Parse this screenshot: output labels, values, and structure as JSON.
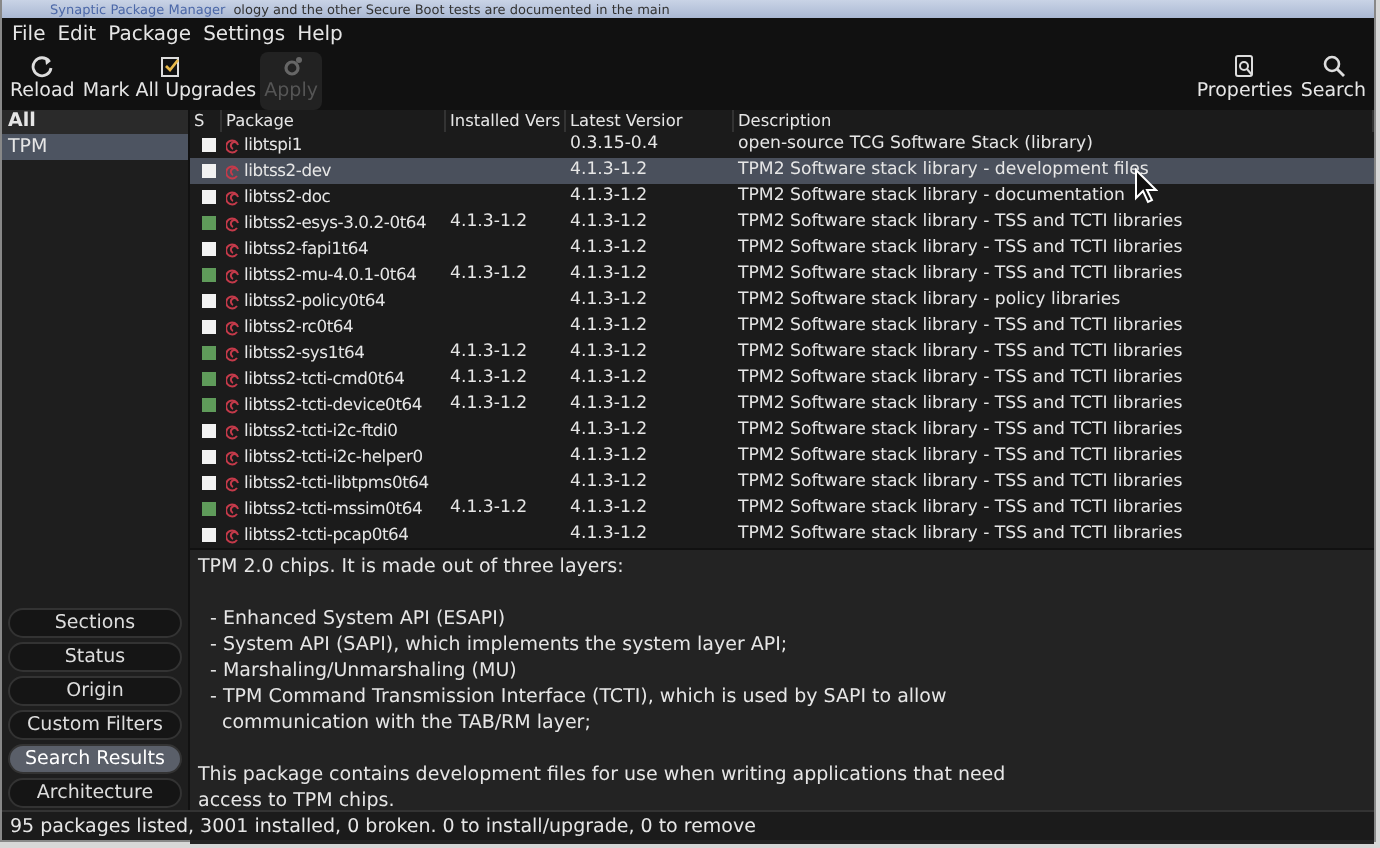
{
  "window": {
    "title": "Synaptic Package Manager",
    "behind_text": "ology and the other Secure Boot tests are documented in the main"
  },
  "menu": [
    "File",
    "Edit",
    "Package",
    "Settings",
    "Help"
  ],
  "toolbar": [
    {
      "label": "Reload",
      "disabled": false
    },
    {
      "label": "Mark All Upgrades",
      "disabled": false
    },
    {
      "label": "Apply",
      "disabled": true
    },
    {
      "label": "Properties",
      "disabled": false
    },
    {
      "label": "Search",
      "disabled": false
    }
  ],
  "filters": {
    "heading": "All",
    "items": [
      {
        "label": "TPM",
        "selected": true
      }
    ]
  },
  "filter_buttons": [
    {
      "label": "Sections",
      "selected": false
    },
    {
      "label": "Status",
      "selected": false
    },
    {
      "label": "Origin",
      "selected": false
    },
    {
      "label": "Custom Filters",
      "selected": false
    },
    {
      "label": "Search Results",
      "selected": true
    },
    {
      "label": "Architecture",
      "selected": false
    }
  ],
  "table": {
    "columns": [
      "S",
      "Package",
      "Installed Vers",
      "Latest Versior",
      "Description"
    ],
    "rows": [
      {
        "installed": false,
        "selected": false,
        "package": "libtspi1",
        "latest": "0.3.15-0.4",
        "description": "open-source TCG Software Stack (library)"
      },
      {
        "installed": false,
        "selected": true,
        "package": "libtss2-dev",
        "latest": "4.1.3-1.2",
        "description": "TPM2 Software stack library - development files"
      },
      {
        "installed": false,
        "selected": false,
        "package": "libtss2-doc",
        "latest": "4.1.3-1.2",
        "description": "TPM2 Software stack library - documentation"
      },
      {
        "installed": true,
        "selected": false,
        "package": "libtss2-esys-3.0.2-0t64",
        "installed_version": "4.1.3-1.2",
        "latest": "4.1.3-1.2",
        "description": "TPM2 Software stack library - TSS and TCTI libraries"
      },
      {
        "installed": false,
        "selected": false,
        "package": "libtss2-fapi1t64",
        "latest": "4.1.3-1.2",
        "description": "TPM2 Software stack library - TSS and TCTI libraries"
      },
      {
        "installed": true,
        "selected": false,
        "package": "libtss2-mu-4.0.1-0t64",
        "installed_version": "4.1.3-1.2",
        "latest": "4.1.3-1.2",
        "description": "TPM2 Software stack library - TSS and TCTI libraries"
      },
      {
        "installed": false,
        "selected": false,
        "package": "libtss2-policy0t64",
        "latest": "4.1.3-1.2",
        "description": "TPM2 Software stack library - policy libraries"
      },
      {
        "installed": false,
        "selected": false,
        "package": "libtss2-rc0t64",
        "latest": "4.1.3-1.2",
        "description": "TPM2 Software stack library - TSS and TCTI libraries"
      },
      {
        "installed": true,
        "selected": false,
        "package": "libtss2-sys1t64",
        "installed_version": "4.1.3-1.2",
        "latest": "4.1.3-1.2",
        "description": "TPM2 Software stack library - TSS and TCTI libraries"
      },
      {
        "installed": true,
        "selected": false,
        "package": "libtss2-tcti-cmd0t64",
        "installed_version": "4.1.3-1.2",
        "latest": "4.1.3-1.2",
        "description": "TPM2 Software stack library - TSS and TCTI libraries"
      },
      {
        "installed": true,
        "selected": false,
        "package": "libtss2-tcti-device0t64",
        "installed_version": "4.1.3-1.2",
        "latest": "4.1.3-1.2",
        "description": "TPM2 Software stack library - TSS and TCTI libraries"
      },
      {
        "installed": false,
        "selected": false,
        "package": "libtss2-tcti-i2c-ftdi0",
        "latest": "4.1.3-1.2",
        "description": "TPM2 Software stack library - TSS and TCTI libraries"
      },
      {
        "installed": false,
        "selected": false,
        "package": "libtss2-tcti-i2c-helper0",
        "latest": "4.1.3-1.2",
        "description": "TPM2 Software stack library - TSS and TCTI libraries"
      },
      {
        "installed": false,
        "selected": false,
        "package": "libtss2-tcti-libtpms0t64",
        "latest": "4.1.3-1.2",
        "description": "TPM2 Software stack library - TSS and TCTI libraries"
      },
      {
        "installed": true,
        "selected": false,
        "package": "libtss2-tcti-mssim0t64",
        "installed_version": "4.1.3-1.2",
        "latest": "4.1.3-1.2",
        "description": "TPM2 Software stack library - TSS and TCTI libraries"
      },
      {
        "installed": false,
        "selected": false,
        "package": "libtss2-tcti-pcap0t64",
        "latest": "4.1.3-1.2",
        "description": "TPM2 Software stack library - TSS and TCTI libraries"
      }
    ]
  },
  "details": [
    {
      "kind": "para",
      "lines": [
        "TPM 2.0 chips. It is made out of three layers:"
      ]
    },
    {
      "kind": "bullets",
      "lines": [
        "- Enhanced System API (ESAPI)",
        "- System API (SAPI), which implements the system layer API;",
        "- Marshaling/Unmarshaling (MU)",
        "- TPM Command Transmission Interface (TCTI), which is used by SAPI to allow communication with the TAB/RM layer;"
      ]
    },
    {
      "kind": "para",
      "lines": [
        "This package contains development files for use when writing applications that need access to TPM chips."
      ]
    }
  ],
  "status_bar": "95 packages listed, 3001 installed, 0 broken. 0 to install/upgrade, 0 to remove"
}
